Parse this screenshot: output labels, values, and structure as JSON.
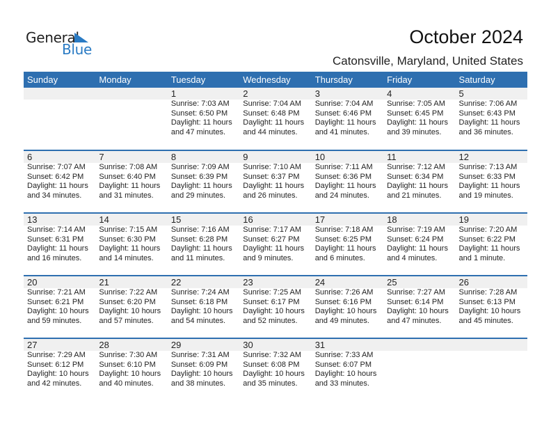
{
  "logo": {
    "general": "General",
    "blue": "Blue",
    "icon": "triangle-flag-icon",
    "accent": "#2a7bc4"
  },
  "header": {
    "title": "October 2024",
    "location": "Catonsville, Maryland, United States"
  },
  "colors": {
    "header_bg": "#2e6fb0",
    "date_strip_bg": "#f0f0f0"
  },
  "weekdays": [
    "Sunday",
    "Monday",
    "Tuesday",
    "Wednesday",
    "Thursday",
    "Friday",
    "Saturday"
  ],
  "weeks": [
    [
      null,
      null,
      {
        "day": "1",
        "sunrise": "Sunrise: 7:03 AM",
        "sunset": "Sunset: 6:50 PM",
        "daylight1": "Daylight: 11 hours",
        "daylight2": "and 47 minutes."
      },
      {
        "day": "2",
        "sunrise": "Sunrise: 7:04 AM",
        "sunset": "Sunset: 6:48 PM",
        "daylight1": "Daylight: 11 hours",
        "daylight2": "and 44 minutes."
      },
      {
        "day": "3",
        "sunrise": "Sunrise: 7:04 AM",
        "sunset": "Sunset: 6:46 PM",
        "daylight1": "Daylight: 11 hours",
        "daylight2": "and 41 minutes."
      },
      {
        "day": "4",
        "sunrise": "Sunrise: 7:05 AM",
        "sunset": "Sunset: 6:45 PM",
        "daylight1": "Daylight: 11 hours",
        "daylight2": "and 39 minutes."
      },
      {
        "day": "5",
        "sunrise": "Sunrise: 7:06 AM",
        "sunset": "Sunset: 6:43 PM",
        "daylight1": "Daylight: 11 hours",
        "daylight2": "and 36 minutes."
      }
    ],
    [
      {
        "day": "6",
        "sunrise": "Sunrise: 7:07 AM",
        "sunset": "Sunset: 6:42 PM",
        "daylight1": "Daylight: 11 hours",
        "daylight2": "and 34 minutes."
      },
      {
        "day": "7",
        "sunrise": "Sunrise: 7:08 AM",
        "sunset": "Sunset: 6:40 PM",
        "daylight1": "Daylight: 11 hours",
        "daylight2": "and 31 minutes."
      },
      {
        "day": "8",
        "sunrise": "Sunrise: 7:09 AM",
        "sunset": "Sunset: 6:39 PM",
        "daylight1": "Daylight: 11 hours",
        "daylight2": "and 29 minutes."
      },
      {
        "day": "9",
        "sunrise": "Sunrise: 7:10 AM",
        "sunset": "Sunset: 6:37 PM",
        "daylight1": "Daylight: 11 hours",
        "daylight2": "and 26 minutes."
      },
      {
        "day": "10",
        "sunrise": "Sunrise: 7:11 AM",
        "sunset": "Sunset: 6:36 PM",
        "daylight1": "Daylight: 11 hours",
        "daylight2": "and 24 minutes."
      },
      {
        "day": "11",
        "sunrise": "Sunrise: 7:12 AM",
        "sunset": "Sunset: 6:34 PM",
        "daylight1": "Daylight: 11 hours",
        "daylight2": "and 21 minutes."
      },
      {
        "day": "12",
        "sunrise": "Sunrise: 7:13 AM",
        "sunset": "Sunset: 6:33 PM",
        "daylight1": "Daylight: 11 hours",
        "daylight2": "and 19 minutes."
      }
    ],
    [
      {
        "day": "13",
        "sunrise": "Sunrise: 7:14 AM",
        "sunset": "Sunset: 6:31 PM",
        "daylight1": "Daylight: 11 hours",
        "daylight2": "and 16 minutes."
      },
      {
        "day": "14",
        "sunrise": "Sunrise: 7:15 AM",
        "sunset": "Sunset: 6:30 PM",
        "daylight1": "Daylight: 11 hours",
        "daylight2": "and 14 minutes."
      },
      {
        "day": "15",
        "sunrise": "Sunrise: 7:16 AM",
        "sunset": "Sunset: 6:28 PM",
        "daylight1": "Daylight: 11 hours",
        "daylight2": "and 11 minutes."
      },
      {
        "day": "16",
        "sunrise": "Sunrise: 7:17 AM",
        "sunset": "Sunset: 6:27 PM",
        "daylight1": "Daylight: 11 hours",
        "daylight2": "and 9 minutes."
      },
      {
        "day": "17",
        "sunrise": "Sunrise: 7:18 AM",
        "sunset": "Sunset: 6:25 PM",
        "daylight1": "Daylight: 11 hours",
        "daylight2": "and 6 minutes."
      },
      {
        "day": "18",
        "sunrise": "Sunrise: 7:19 AM",
        "sunset": "Sunset: 6:24 PM",
        "daylight1": "Daylight: 11 hours",
        "daylight2": "and 4 minutes."
      },
      {
        "day": "19",
        "sunrise": "Sunrise: 7:20 AM",
        "sunset": "Sunset: 6:22 PM",
        "daylight1": "Daylight: 11 hours",
        "daylight2": "and 1 minute."
      }
    ],
    [
      {
        "day": "20",
        "sunrise": "Sunrise: 7:21 AM",
        "sunset": "Sunset: 6:21 PM",
        "daylight1": "Daylight: 10 hours",
        "daylight2": "and 59 minutes."
      },
      {
        "day": "21",
        "sunrise": "Sunrise: 7:22 AM",
        "sunset": "Sunset: 6:20 PM",
        "daylight1": "Daylight: 10 hours",
        "daylight2": "and 57 minutes."
      },
      {
        "day": "22",
        "sunrise": "Sunrise: 7:24 AM",
        "sunset": "Sunset: 6:18 PM",
        "daylight1": "Daylight: 10 hours",
        "daylight2": "and 54 minutes."
      },
      {
        "day": "23",
        "sunrise": "Sunrise: 7:25 AM",
        "sunset": "Sunset: 6:17 PM",
        "daylight1": "Daylight: 10 hours",
        "daylight2": "and 52 minutes."
      },
      {
        "day": "24",
        "sunrise": "Sunrise: 7:26 AM",
        "sunset": "Sunset: 6:16 PM",
        "daylight1": "Daylight: 10 hours",
        "daylight2": "and 49 minutes."
      },
      {
        "day": "25",
        "sunrise": "Sunrise: 7:27 AM",
        "sunset": "Sunset: 6:14 PM",
        "daylight1": "Daylight: 10 hours",
        "daylight2": "and 47 minutes."
      },
      {
        "day": "26",
        "sunrise": "Sunrise: 7:28 AM",
        "sunset": "Sunset: 6:13 PM",
        "daylight1": "Daylight: 10 hours",
        "daylight2": "and 45 minutes."
      }
    ],
    [
      {
        "day": "27",
        "sunrise": "Sunrise: 7:29 AM",
        "sunset": "Sunset: 6:12 PM",
        "daylight1": "Daylight: 10 hours",
        "daylight2": "and 42 minutes."
      },
      {
        "day": "28",
        "sunrise": "Sunrise: 7:30 AM",
        "sunset": "Sunset: 6:10 PM",
        "daylight1": "Daylight: 10 hours",
        "daylight2": "and 40 minutes."
      },
      {
        "day": "29",
        "sunrise": "Sunrise: 7:31 AM",
        "sunset": "Sunset: 6:09 PM",
        "daylight1": "Daylight: 10 hours",
        "daylight2": "and 38 minutes."
      },
      {
        "day": "30",
        "sunrise": "Sunrise: 7:32 AM",
        "sunset": "Sunset: 6:08 PM",
        "daylight1": "Daylight: 10 hours",
        "daylight2": "and 35 minutes."
      },
      {
        "day": "31",
        "sunrise": "Sunrise: 7:33 AM",
        "sunset": "Sunset: 6:07 PM",
        "daylight1": "Daylight: 10 hours",
        "daylight2": "and 33 minutes."
      },
      null,
      null
    ]
  ]
}
